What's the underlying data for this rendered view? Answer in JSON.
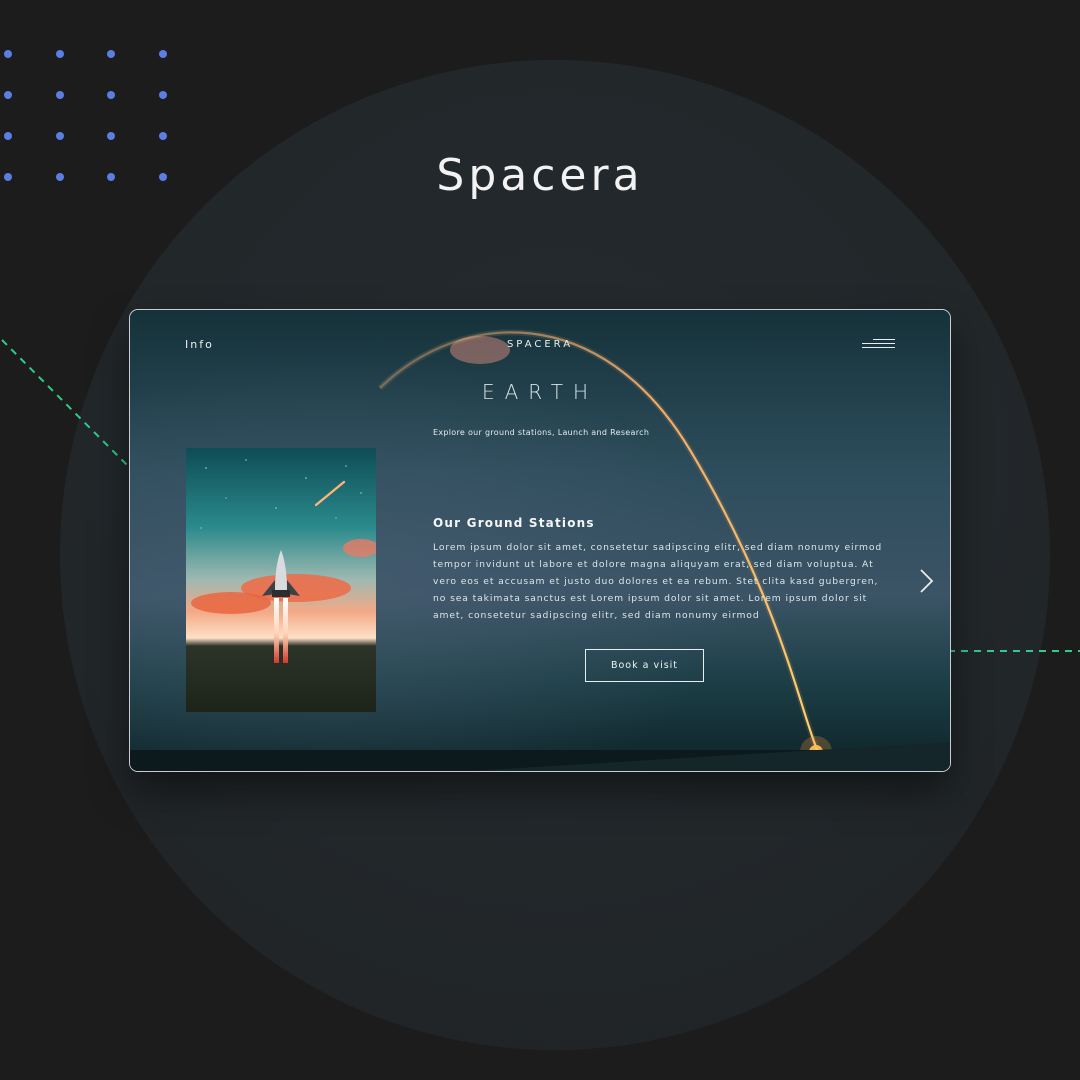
{
  "brand": {
    "title": "Spacera"
  },
  "site": {
    "nav": {
      "info_label": "Info",
      "logo": "SPACERA",
      "menu_icon": "hamburger-menu-icon"
    },
    "hero": {
      "planet": "EARTH",
      "subtitle": "Explore our ground stations, Launch and Research",
      "section_heading": "Our Ground Stations",
      "body": "Lorem ipsum dolor sit amet, consetetur sadipscing elitr, sed diam nonumy eirmod tempor invidunt ut labore et dolore magna aliquyam erat, sed diam voluptua. At vero eos et accusam et justo duo dolores et ea rebum. Stet clita kasd gubergren, no sea takimata sanctus est Lorem ipsum dolor sit amet. Lorem ipsum dolor sit amet, consetetur sadipscing elitr, sed diam nonumy eirmod",
      "cta_label": "Book a visit",
      "next_icon": "chevron-right-icon"
    }
  },
  "colors": {
    "page_bg": "#1c1c1c",
    "circle_bg": "#23282b",
    "dot_accent": "#5b7ee5",
    "dash_accent": "#2ecc8a",
    "text_light": "#f2f2f2"
  }
}
